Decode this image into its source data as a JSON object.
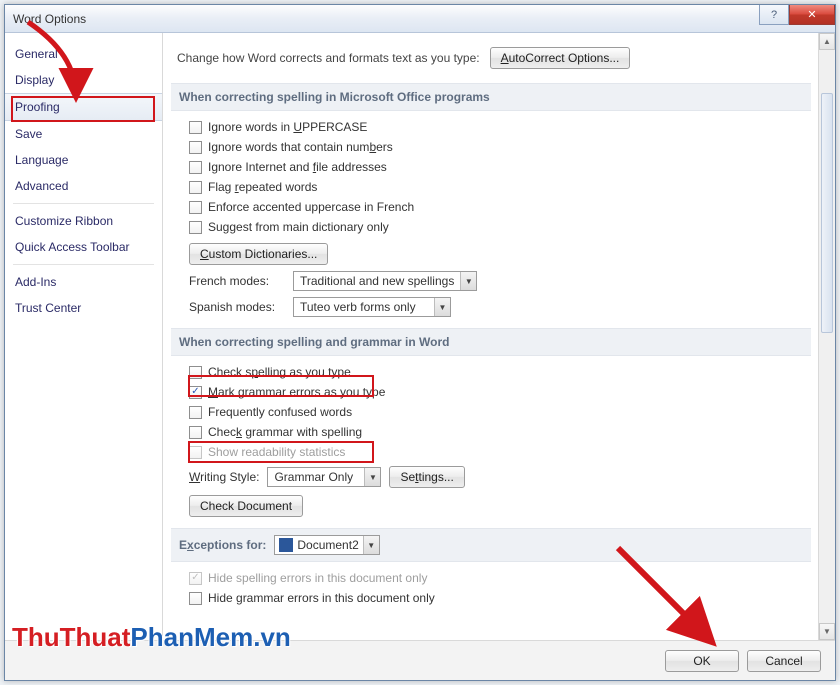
{
  "titlebar": {
    "title": "Word Options"
  },
  "sidebar": {
    "items": [
      {
        "label": "General",
        "sep_after": false
      },
      {
        "label": "Display",
        "sep_after": false
      },
      {
        "label": "Proofing",
        "selected": true,
        "sep_after": false
      },
      {
        "label": "Save",
        "sep_after": false
      },
      {
        "label": "Language",
        "sep_after": false
      },
      {
        "label": "Advanced",
        "sep_after": true
      },
      {
        "label": "Customize Ribbon",
        "sep_after": false
      },
      {
        "label": "Quick Access Toolbar",
        "sep_after": true
      },
      {
        "label": "Add-Ins",
        "sep_after": false
      },
      {
        "label": "Trust Center",
        "sep_after": false
      }
    ]
  },
  "intro": {
    "text": "Change how Word corrects and formats text as you type:",
    "button": "AutoCorrect Options..."
  },
  "group1": {
    "title": "When correcting spelling in Microsoft Office programs",
    "options": [
      {
        "key": "uppercase",
        "pre": "Ignore words in ",
        "u": "U",
        "post": "PPERCASE",
        "checked": false
      },
      {
        "key": "numbers",
        "pre": "Ignore words that contain num",
        "u": "b",
        "post": "ers",
        "checked": false
      },
      {
        "key": "internet",
        "pre": "Ignore Internet and ",
        "u": "f",
        "post": "ile addresses",
        "checked": false
      },
      {
        "key": "repeated",
        "pre": "Flag ",
        "u": "r",
        "post": "epeated words",
        "checked": false
      },
      {
        "key": "french-accent",
        "pre": "Enforce accented uppercase in French",
        "u": "",
        "post": "",
        "checked": false
      },
      {
        "key": "main-dict",
        "pre": "Suggest from main dictionary only",
        "u": "",
        "post": "",
        "checked": false
      }
    ],
    "custom_dict_btn": "Custom Dictionaries...",
    "french_label": "French modes:",
    "french_value": "Traditional and new spellings",
    "spanish_label": "Spanish modes:",
    "spanish_value": "Tuteo verb forms only"
  },
  "group2": {
    "title": "When correcting spelling and grammar in Word",
    "options": [
      {
        "key": "check-spelling",
        "pre": "Check s",
        "u": "p",
        "post": "elling as you type",
        "checked": false,
        "boxed": true
      },
      {
        "key": "mark-grammar",
        "pre": "",
        "u": "M",
        "post": "ark grammar errors as you type",
        "checked": true
      },
      {
        "key": "confused",
        "pre": "Frequently confused words",
        "u": "",
        "post": "",
        "checked": false
      },
      {
        "key": "grammar-spelling",
        "pre": "Chec",
        "u": "k",
        "post": " grammar with spelling",
        "checked": false,
        "boxed": true
      },
      {
        "key": "readability",
        "pre": "Show readability statistics",
        "u": "",
        "post": "",
        "checked": false,
        "disabled": true
      }
    ],
    "writing_style_label": "Writing Style:",
    "writing_style_value": "Grammar Only",
    "settings_btn": "Settings...",
    "check_doc_btn": "Check Document"
  },
  "group3": {
    "title_pre": "E",
    "title_u": "x",
    "title_post": "ceptions for:",
    "doc_value": "Document2",
    "opt_hide_spelling": "Hide spelling errors in this document only",
    "opt_hide_grammar": "Hide grammar errors in this document only"
  },
  "footer": {
    "ok": "OK",
    "cancel": "Cancel"
  },
  "watermark": {
    "part1": "ThuThuat",
    "part2": "PhanMem",
    "part3": ".vn"
  }
}
